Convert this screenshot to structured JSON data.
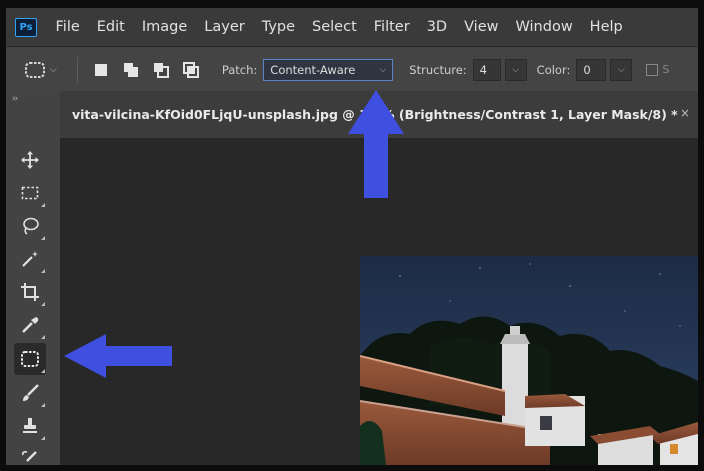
{
  "app": {
    "logo_text": "Ps"
  },
  "menu": [
    "File",
    "Edit",
    "Image",
    "Layer",
    "Type",
    "Select",
    "Filter",
    "3D",
    "View",
    "Window",
    "Help"
  ],
  "options": {
    "patch_label": "Patch:",
    "patch_value": "Content-Aware",
    "structure_label": "Structure:",
    "structure_value": "4",
    "color_label": "Color:",
    "color_value": "0",
    "sample_fragment": "S"
  },
  "document": {
    "title": "vita-vilcina-KfOid0FLjqU-unsplash.jpg @ 1...% (Brightness/Contrast 1, Layer Mask/8) *",
    "close": "×"
  },
  "toolbar": {
    "collapse": "››",
    "tools": [
      {
        "name": "move-tool",
        "icon": "move-icon"
      },
      {
        "name": "marquee-tool",
        "icon": "marquee-icon"
      },
      {
        "name": "lasso-tool",
        "icon": "lasso-icon"
      },
      {
        "name": "magic-wand-tool",
        "icon": "magic-wand-icon"
      },
      {
        "name": "crop-tool",
        "icon": "crop-icon"
      },
      {
        "name": "eyedropper-tool",
        "icon": "eyedropper-icon"
      },
      {
        "name": "patch-tool",
        "icon": "patch-icon",
        "active": true
      },
      {
        "name": "brush-tool",
        "icon": "brush-icon"
      },
      {
        "name": "stamp-tool",
        "icon": "stamp-icon"
      },
      {
        "name": "history-brush-tool",
        "icon": "history-brush-icon"
      }
    ]
  },
  "colors": {
    "annotation_arrow": "#3f4fe0",
    "ui_dark": "#282828",
    "menubar": "#3a3a3a",
    "highlight_border": "#5a84c4"
  }
}
